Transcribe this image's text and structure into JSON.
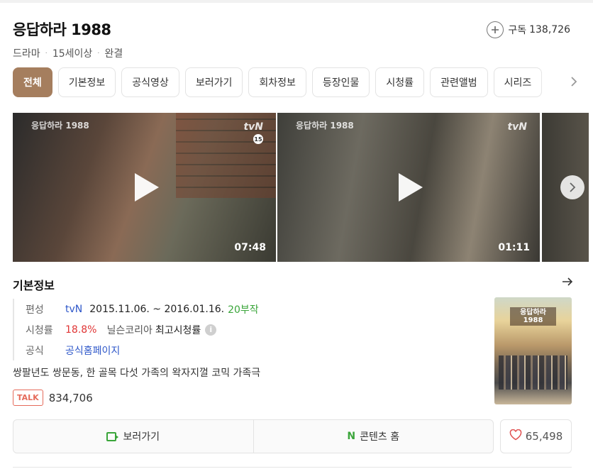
{
  "header": {
    "title": "응답하라 1988",
    "meta": [
      "드라마",
      "15세이상",
      "완결"
    ],
    "subscribe_label": "구독",
    "subscribe_count": "138,726"
  },
  "tabs": [
    "전체",
    "기본정보",
    "공식영상",
    "보러가기",
    "회차정보",
    "등장인물",
    "시청률",
    "관련앨범",
    "시리즈"
  ],
  "videos": [
    {
      "duration": "07:48",
      "channel": "tvN",
      "logo": "응답하라 1988"
    },
    {
      "duration": "01:11",
      "channel": "tvN",
      "logo": "응답하라 1988"
    }
  ],
  "info": {
    "section_title": "기본정보",
    "broadcast_label": "편성",
    "channel": "tvN",
    "period": "2015.11.06. ~ 2016.01.16.",
    "episodes": "20부작",
    "rating_label": "시청률",
    "rating_value": "18.8%",
    "rating_source": "닐슨코리아",
    "rating_type": "최고시청률",
    "official_label": "공식",
    "official_link": "공식홈페이지",
    "description": "쌍팔년도 쌍문동, 한 골목 다섯 가족의 왁자지껄 코믹 가족극",
    "talk_tag": "TALK",
    "talk_count": "834,706",
    "poster_title": "응답하라 1988"
  },
  "actions": {
    "watch_label": "보러가기",
    "content_home_label": "콘텐츠 홈",
    "like_count": "65,498"
  },
  "colors": {
    "active_tab": "#a57e5e",
    "link": "#2e57c9",
    "green": "#3aa53a",
    "red": "#e03535"
  }
}
